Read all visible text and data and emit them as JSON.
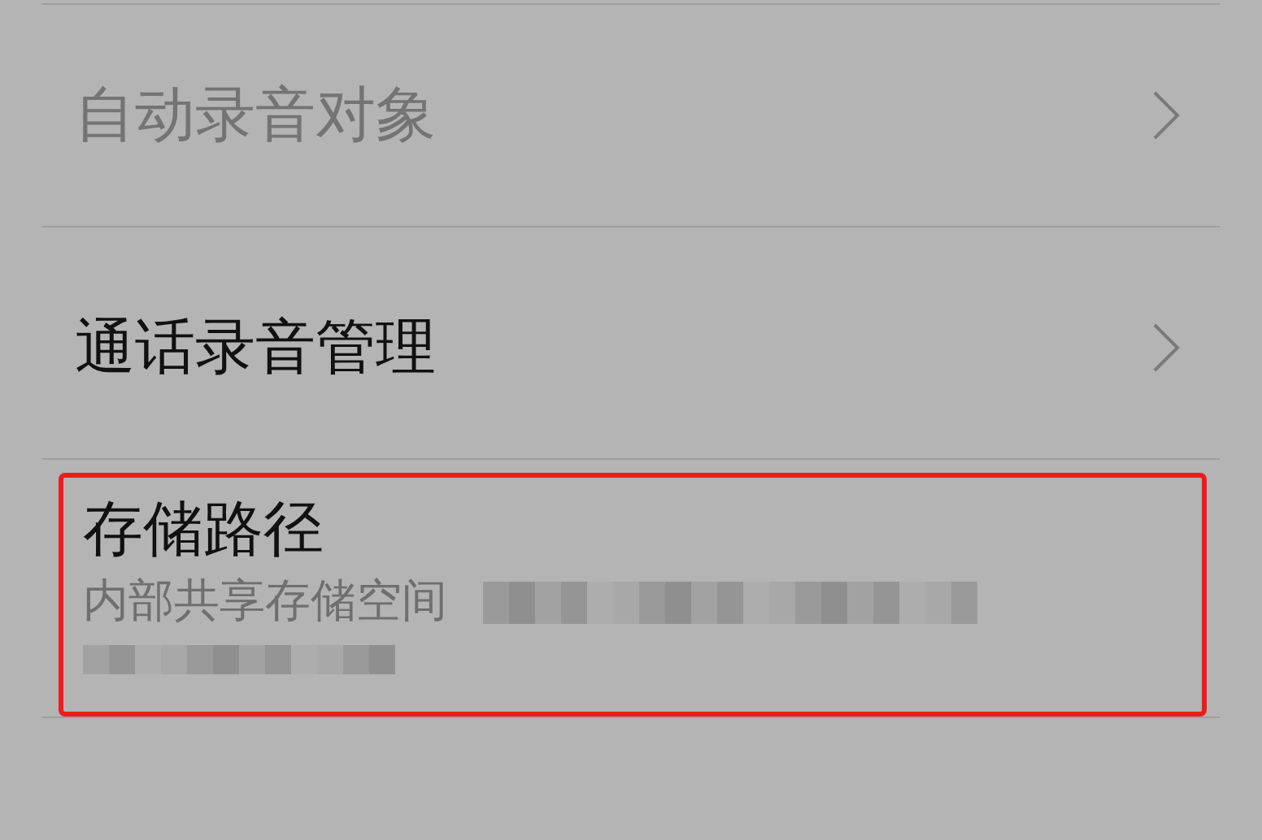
{
  "settings": [
    {
      "title": "自动录音对象",
      "disabled": true,
      "chevron": true,
      "highlighted": false
    },
    {
      "title": "通话录音管理",
      "disabled": false,
      "chevron": true,
      "highlighted": false
    },
    {
      "title": "存储路径",
      "subtitle": "内部共享存储空间",
      "disabled": false,
      "chevron": false,
      "highlighted": true,
      "redacted": true
    }
  ]
}
